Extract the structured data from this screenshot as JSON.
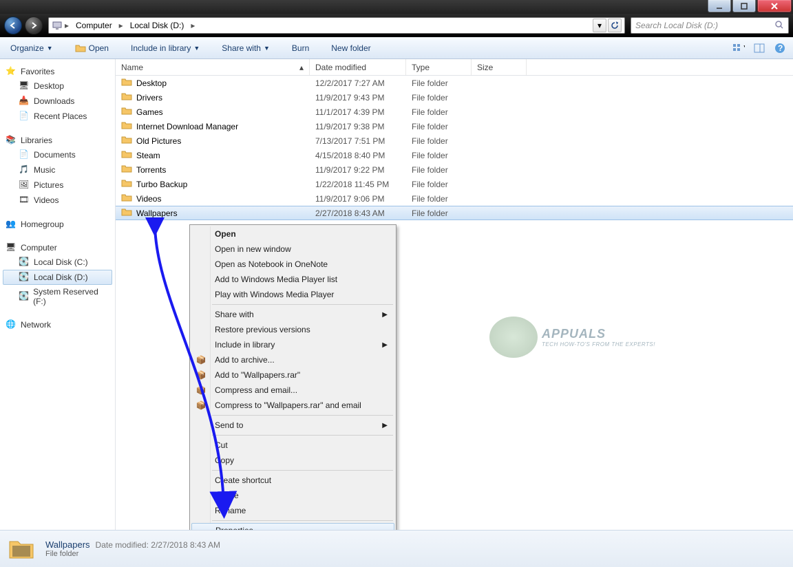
{
  "breadcrumb": {
    "root": "Computer",
    "loc": "Local Disk (D:)"
  },
  "search": {
    "placeholder": "Search Local Disk (D:)"
  },
  "toolbar": {
    "organize": "Organize",
    "open": "Open",
    "include": "Include in library",
    "share": "Share with",
    "burn": "Burn",
    "newfolder": "New folder"
  },
  "sidebar": {
    "favorites": {
      "label": "Favorites",
      "items": [
        "Desktop",
        "Downloads",
        "Recent Places"
      ]
    },
    "libraries": {
      "label": "Libraries",
      "items": [
        "Documents",
        "Music",
        "Pictures",
        "Videos"
      ]
    },
    "homegroup": {
      "label": "Homegroup"
    },
    "computer": {
      "label": "Computer",
      "items": [
        "Local Disk (C:)",
        "Local Disk (D:)",
        "System Reserved (F:)"
      ]
    },
    "network": {
      "label": "Network"
    }
  },
  "columns": {
    "name": "Name",
    "date": "Date modified",
    "type": "Type",
    "size": "Size"
  },
  "rows": [
    {
      "name": "Desktop",
      "date": "12/2/2017 7:27 AM",
      "type": "File folder"
    },
    {
      "name": "Drivers",
      "date": "11/9/2017 9:43 PM",
      "type": "File folder"
    },
    {
      "name": "Games",
      "date": "11/1/2017 4:39 PM",
      "type": "File folder"
    },
    {
      "name": "Internet Download Manager",
      "date": "11/9/2017 9:38 PM",
      "type": "File folder"
    },
    {
      "name": "Old Pictures",
      "date": "7/13/2017 7:51 PM",
      "type": "File folder"
    },
    {
      "name": "Steam",
      "date": "4/15/2018 8:40 PM",
      "type": "File folder"
    },
    {
      "name": "Torrents",
      "date": "11/9/2017 9:22 PM",
      "type": "File folder"
    },
    {
      "name": "Turbo Backup",
      "date": "1/22/2018 11:45 PM",
      "type": "File folder"
    },
    {
      "name": "Videos",
      "date": "11/9/2017 9:06 PM",
      "type": "File folder"
    },
    {
      "name": "Wallpapers",
      "date": "2/27/2018 8:43 AM",
      "type": "File folder"
    }
  ],
  "ctx": {
    "open": "Open",
    "openwin": "Open in new window",
    "openone": "Open as Notebook in OneNote",
    "addwmp": "Add to Windows Media Player list",
    "playwmp": "Play with Windows Media Player",
    "sharewith": "Share with",
    "restore": "Restore previous versions",
    "include": "Include in library",
    "addarchive": "Add to archive...",
    "addrar": "Add to \"Wallpapers.rar\"",
    "compmail": "Compress and email...",
    "comprarmail": "Compress to \"Wallpapers.rar\" and email",
    "sendto": "Send to",
    "cut": "Cut",
    "copy": "Copy",
    "shortcut": "Create shortcut",
    "delete": "Delete",
    "rename": "Rename",
    "properties": "Properties"
  },
  "details": {
    "name": "Wallpapers",
    "modlabel": "Date modified:",
    "mod": "2/27/2018 8:43 AM",
    "type": "File folder"
  },
  "watermark": {
    "brand": "APPUALS",
    "tag": "TECH HOW-TO'S FROM THE EXPERTS!"
  }
}
